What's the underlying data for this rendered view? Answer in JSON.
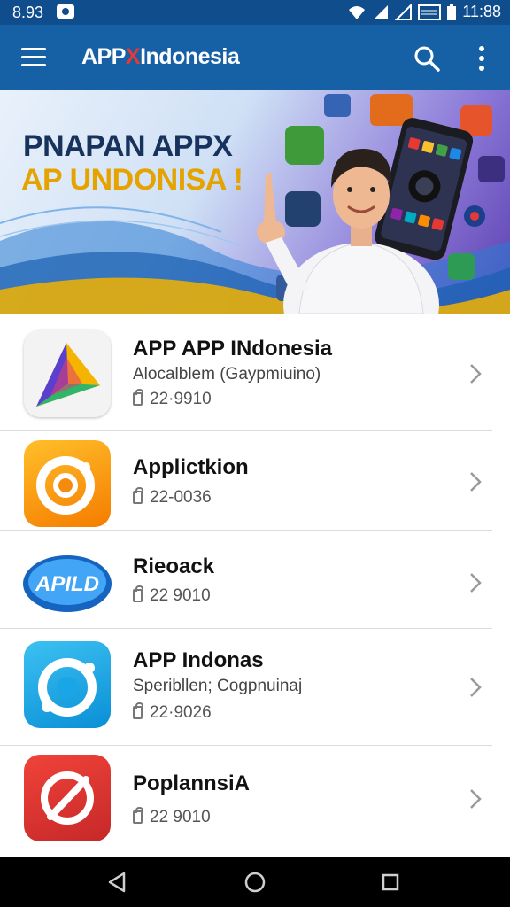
{
  "status_bar": {
    "time_left": "8.93",
    "time_right": "11:88"
  },
  "app_bar": {
    "title_prefix": "APP",
    "title_x": "X",
    "title_suffix": "Indonesia"
  },
  "banner": {
    "line1": "PNAPAN APPX",
    "line2": "AP UNDONISA !"
  },
  "apps": [
    {
      "name": "APP APP INdonesia",
      "subtitle": "Alocalblem (Gaypmiuino)",
      "size": "22·9910"
    },
    {
      "name": "Applictkion",
      "subtitle": "",
      "size": "22-0036"
    },
    {
      "name": "Rieoack",
      "subtitle": "",
      "size": "22 9010",
      "icon_text": "APILD"
    },
    {
      "name": "APP Indonas",
      "subtitle": "Speribllen; Cogpnuinaj",
      "size": "22·9026"
    },
    {
      "name": "PoplannsiA",
      "subtitle": "",
      "size": "22 9010"
    }
  ],
  "colors": {
    "status_bar": "#0f4d8c",
    "app_bar": "#1660a6",
    "accent_yellow": "#e5a300"
  },
  "icons": [
    "menu-icon",
    "search-icon",
    "more-vert-icon",
    "chevron-right-icon",
    "back-icon",
    "home-icon",
    "recents-icon"
  ]
}
